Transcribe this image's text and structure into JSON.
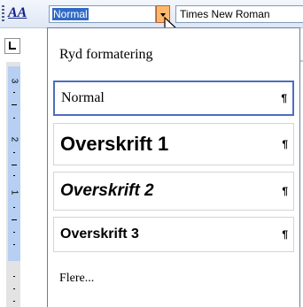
{
  "toolbar": {
    "style_icon_glyph": "A",
    "current_style": "Normal",
    "current_font": "Times New Roman",
    "dropdown_accent": "#fdb86a"
  },
  "ruler": {
    "numbers": [
      "3",
      "2",
      "1"
    ]
  },
  "menu": {
    "items": [
      {
        "label": "Ryd formatering",
        "pilcrow": ""
      },
      {
        "label": "Normal",
        "pilcrow": "¶"
      },
      {
        "label": "Overskrift 1",
        "pilcrow": "¶"
      },
      {
        "label": "Overskrift 2",
        "pilcrow": "¶"
      },
      {
        "label": "Overskrift 3",
        "pilcrow": "¶"
      },
      {
        "label": "Flere...",
        "pilcrow": ""
      }
    ]
  },
  "colors": {
    "selection": "#316ac5",
    "selected_border": "#4a6fbd",
    "ruler_blue": "#b6cff3"
  }
}
